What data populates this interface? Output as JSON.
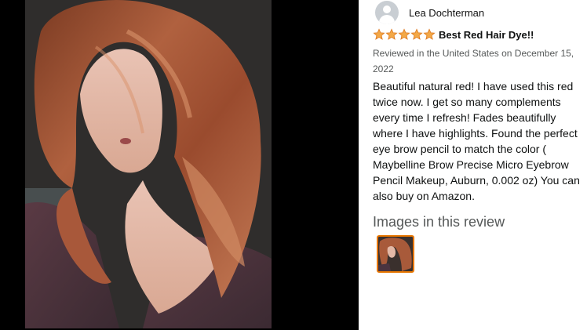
{
  "review": {
    "reviewer_name": "Lea Dochterman",
    "rating": 5,
    "rating_max": 5,
    "title": "Best Red Hair Dye!!",
    "meta": "Reviewed in the United States on December 15, 2022",
    "body": "Beautiful natural red! I have used this red twice now. I get so many complements every time I refresh! Fades beautifully where I have highlights. Found the perfect eye brow pencil to match the color ( Maybelline Brow Precise Micro Eyebrow Pencil Makeup, Auburn, 0.002 oz) You can also buy on Amazon."
  },
  "images_section": {
    "heading": "Images in this review",
    "count": 1
  },
  "icons": {
    "avatar": "user-silhouette-icon",
    "star": "star-filled-icon"
  },
  "colors": {
    "star": "#f3a847",
    "star_outline": "#de7921",
    "thumb_border": "#e77600",
    "meta_text": "#565959"
  }
}
